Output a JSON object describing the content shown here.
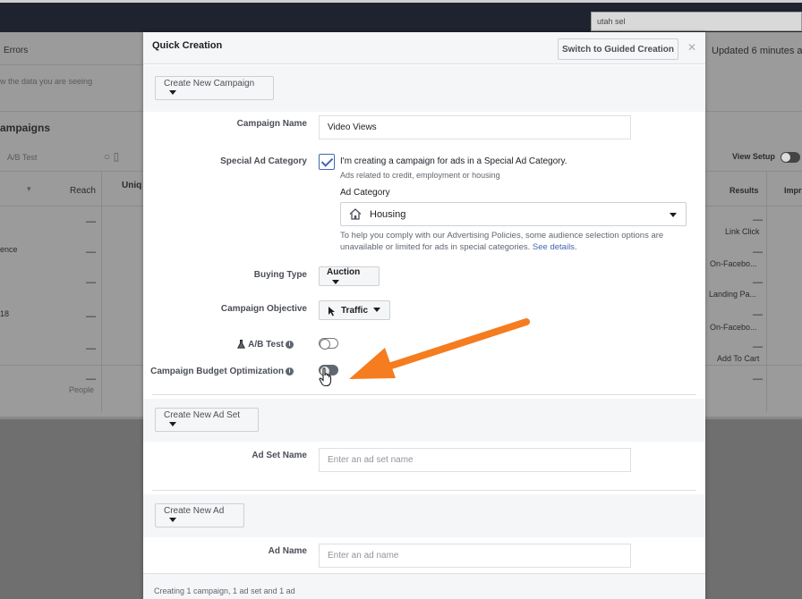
{
  "background": {
    "search_value": "utah sel",
    "errors_label": "Errors",
    "data_hint": "w the data you are seeing",
    "campaigns_label": "ampaigns",
    "ab_test_label": "A/B Test",
    "updated_text": "Updated 6 minutes a",
    "view_setup_label": "View Setup",
    "col_reach": "Reach",
    "col_unique": "Uniq",
    "col_results": "Results",
    "col_impressions": "Impr",
    "row_dash": "—",
    "row_label_ence": "ence",
    "row_label_18": "18",
    "people_label": "People",
    "results": [
      "Link Click",
      "On-Facebo...",
      "Landing Pa...",
      "On-Facebo...",
      "Add To Cart"
    ]
  },
  "modal": {
    "title": "Quick Creation",
    "guided_button": "Switch to Guided Creation",
    "close_glyph": "✕",
    "campaign_section_button": "Create New Campaign",
    "campaign_name_label": "Campaign Name",
    "campaign_name_value": "Video Views",
    "special_ad_category_label": "Special Ad Category",
    "special_ad_checkbox_text": "I'm creating a campaign for ads in a Special Ad Category.",
    "special_ad_subtext": "Ads related to credit, employment or housing",
    "ad_category_label": "Ad Category",
    "ad_category_value": "Housing",
    "policy_text_1": "To help you comply with our Advertising Policies, some audience selection options are",
    "policy_text_2": "unavailable or limited for ads in special categories.",
    "see_details": "See details.",
    "buying_type_label": "Buying Type",
    "buying_type_value": "Auction",
    "objective_label": "Campaign Objective",
    "objective_value": "Traffic",
    "ab_test_label": "A/B Test",
    "cbo_label": "Campaign Budget Optimization",
    "ad_set_section_button": "Create New Ad Set",
    "ad_set_name_label": "Ad Set Name",
    "ad_set_name_placeholder": "Enter an ad set name",
    "ad_section_button": "Create New Ad",
    "ad_name_label": "Ad Name",
    "ad_name_placeholder": "Enter an ad name",
    "footer_text": "Creating 1 campaign, 1 ad set and 1 ad"
  },
  "colors": {
    "accent": "#4267b2",
    "arrow": "#f57c1f"
  }
}
